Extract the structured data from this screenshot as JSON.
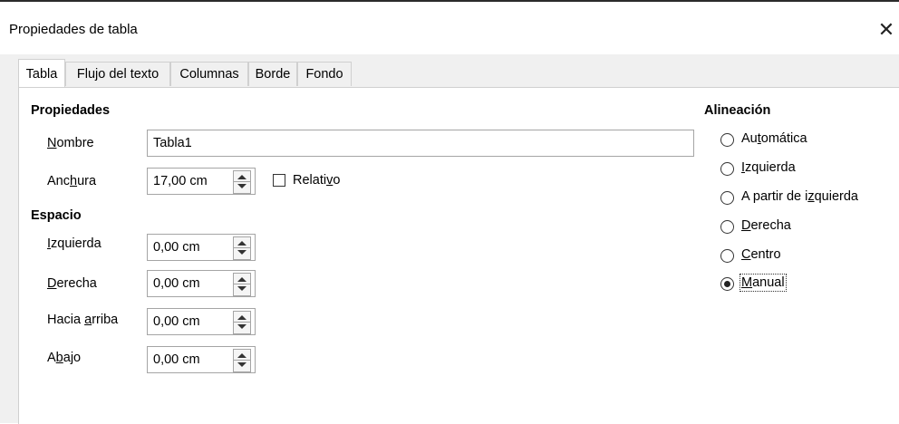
{
  "window": {
    "title": "Propiedades de tabla",
    "close_glyph": "✕"
  },
  "tabs": [
    {
      "label": "Tabla",
      "active": true
    },
    {
      "label": "Flujo del texto",
      "active": false
    },
    {
      "label": "Columnas",
      "active": false
    },
    {
      "label": "Borde",
      "active": false
    },
    {
      "label": "Fondo",
      "active": false
    }
  ],
  "properties": {
    "heading": "Propiedades",
    "name_label_pre": "",
    "name_label_u": "N",
    "name_label_post": "ombre",
    "name_value": "Tabla1",
    "width_label_pre": "Anc",
    "width_label_u": "h",
    "width_label_post": "ura",
    "width_value": "17,00 cm",
    "relative_label_pre": "Relati",
    "relative_label_u": "v",
    "relative_label_post": "o",
    "relative_checked": false
  },
  "spacing": {
    "heading": "Espacio",
    "left": {
      "pre": "",
      "u": "I",
      "post": "zquierda",
      "value": "0,00 cm"
    },
    "right": {
      "pre": "",
      "u": "D",
      "post": "erecha",
      "value": "0,00 cm"
    },
    "above": {
      "pre": "Hacia ",
      "u": "a",
      "post": "rriba",
      "value": "0,00 cm"
    },
    "below": {
      "pre": "A",
      "u": "b",
      "post": "ajo",
      "value": "0,00 cm"
    }
  },
  "alignment": {
    "heading": "Alineación",
    "options": [
      {
        "pre": "Au",
        "u": "t",
        "post": "omática",
        "selected": false
      },
      {
        "pre": "",
        "u": "I",
        "post": "zquierda",
        "selected": false
      },
      {
        "pre": "A partir de i",
        "u": "z",
        "post": "quierda",
        "selected": false
      },
      {
        "pre": "",
        "u": "D",
        "post": "erecha",
        "selected": false
      },
      {
        "pre": "",
        "u": "C",
        "post": "entro",
        "selected": false
      },
      {
        "pre": "",
        "u": "M",
        "post": "anual",
        "selected": true
      }
    ]
  }
}
